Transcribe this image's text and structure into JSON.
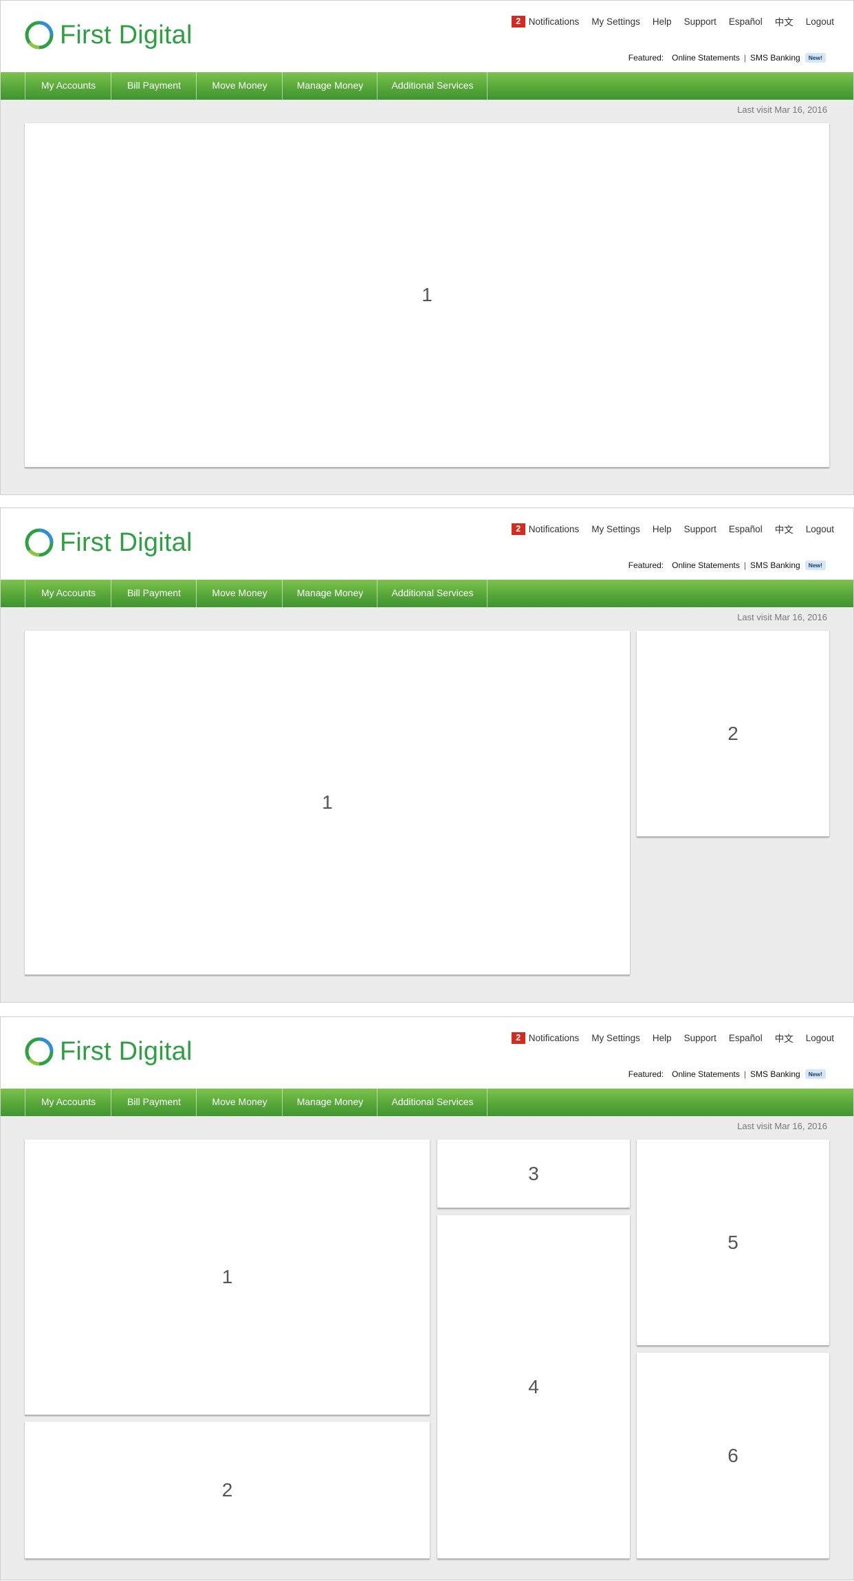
{
  "brand": {
    "name": "First Digital",
    "color": "#2ea043"
  },
  "header": {
    "notifications": {
      "count": "2",
      "label": "Notifications"
    },
    "links": [
      "My Settings",
      "Help",
      "Support",
      "Español",
      "中文",
      "Logout"
    ],
    "featured": {
      "label": "Featured:",
      "items": [
        "Online Statements",
        "SMS Banking"
      ],
      "new_badge": "New!"
    }
  },
  "nav": [
    "My Accounts",
    "Bill Payment",
    "Move Money",
    "Manage Money",
    "Additional Services"
  ],
  "last_visit": "Last visit Mar 16, 2016",
  "colors": {
    "nav_green": "#57a83a",
    "badge_red": "#d42a1f",
    "background": "#ececec"
  },
  "layouts": [
    {
      "panels": [
        "1"
      ]
    },
    {
      "panels": [
        "1",
        "2"
      ]
    },
    {
      "panels": [
        "1",
        "2",
        "3",
        "4",
        "5",
        "6"
      ]
    }
  ]
}
